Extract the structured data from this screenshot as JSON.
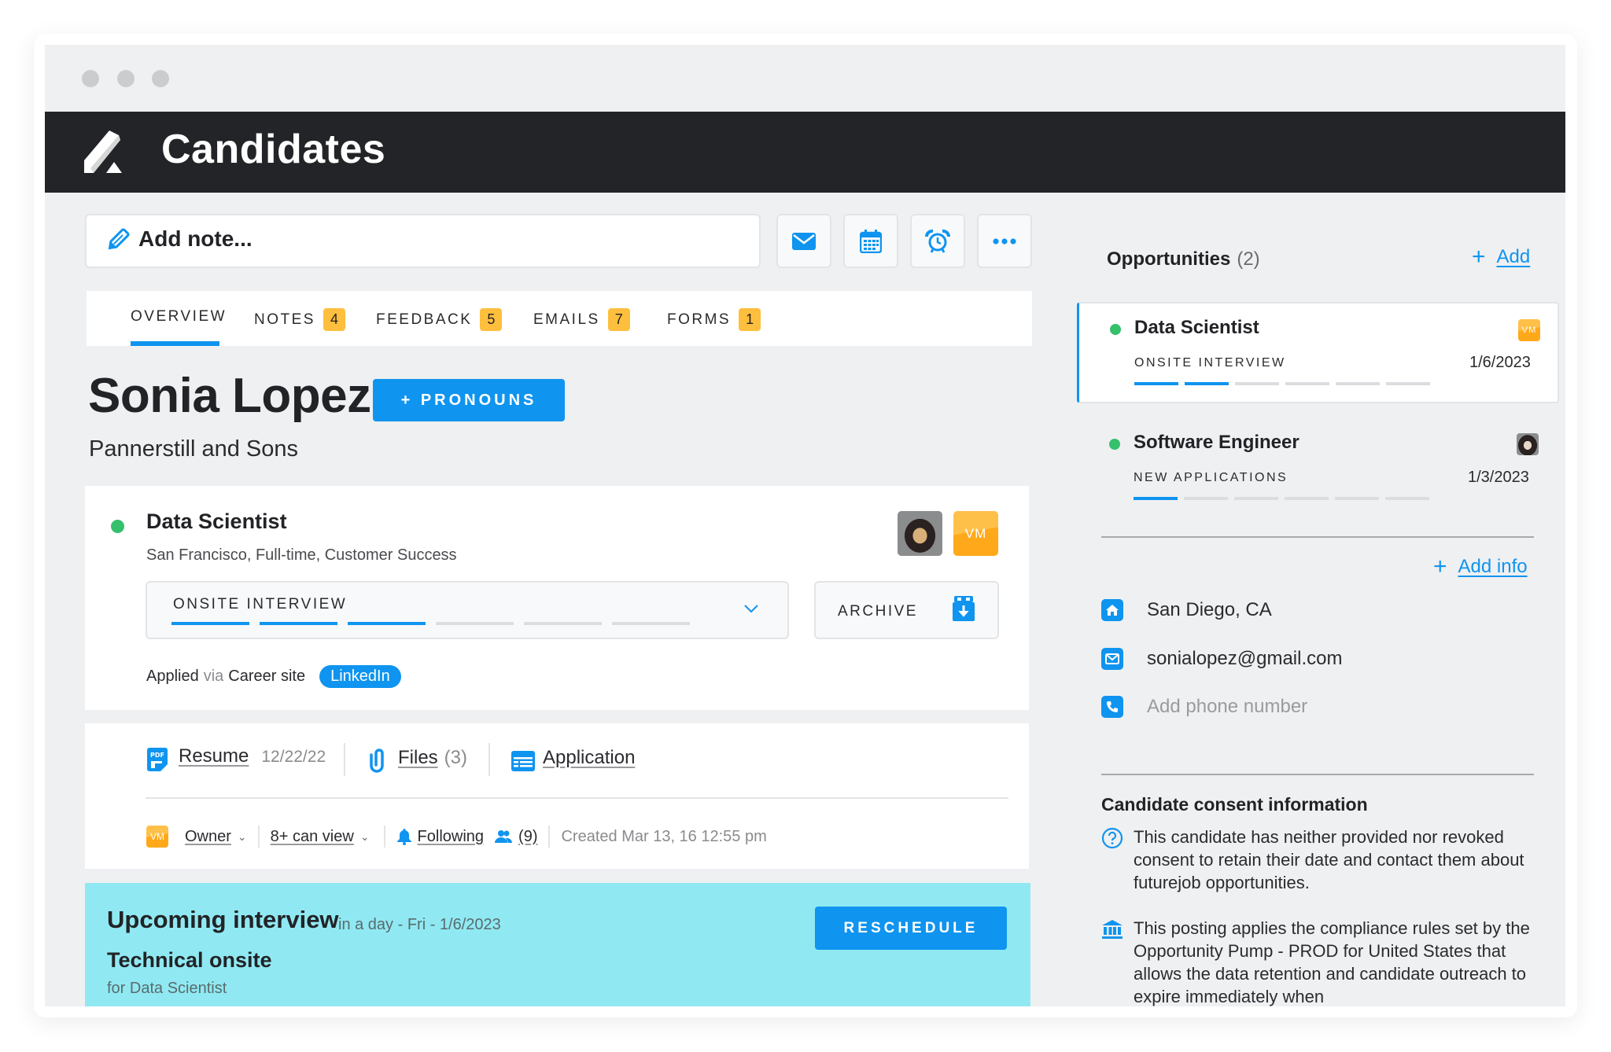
{
  "window": {
    "title": "Candidates"
  },
  "toolbar": {
    "note_placeholder": "Add note...",
    "buttons": [
      {
        "name": "email",
        "icon": "envelope-icon"
      },
      {
        "name": "schedule",
        "icon": "calendar-icon"
      },
      {
        "name": "reminder",
        "icon": "alarm-clock-icon"
      },
      {
        "name": "more",
        "icon": "more-dots-icon"
      }
    ]
  },
  "tabs": [
    {
      "label": "OVERVIEW",
      "count": null,
      "active": true
    },
    {
      "label": "NOTES",
      "count": "4"
    },
    {
      "label": "FEEDBACK",
      "count": "5"
    },
    {
      "label": "EMAILS",
      "count": "7"
    },
    {
      "label": "FORMS",
      "count": "1"
    }
  ],
  "candidate": {
    "name": "Sonia Lopez",
    "pronouns_button": "+ PRONOUNS",
    "company": "Pannerstill and Sons"
  },
  "job": {
    "title": "Data Scientist",
    "details": "San Francisco, Full-time, Customer Success",
    "owner_initials": "VM",
    "stage": "ONSITE INTERVIEW",
    "stage_progress": {
      "completed": 3,
      "total": 6
    },
    "archive_label": "ARCHIVE",
    "applied_label": "Applied",
    "via_label": "via",
    "source": "Career site",
    "source_tag": "LinkedIn"
  },
  "documents": {
    "resume_label": "Resume",
    "resume_date": "12/22/22",
    "files_label": "Files",
    "files_count": "(3)",
    "application_label": "Application",
    "owner_initials": "VM",
    "owner_label": "Owner",
    "visibility_label": "8+ can view",
    "following_label": "Following",
    "followers_count": "(9)",
    "created": "Created Mar 13, 16 12:55 pm"
  },
  "upcoming_interview": {
    "title": "Upcoming interview",
    "when": "in a day - Fri - 1/6/2023",
    "name": "Technical onsite",
    "for": "for Data Scientist",
    "reschedule_label": "RESCHEDULE"
  },
  "opportunities": {
    "title": "Opportunities",
    "count": "(2)",
    "add_label": "Add",
    "items": [
      {
        "title": "Data Scientist",
        "stage": "ONSITE INTERVIEW",
        "date": "1/6/2023",
        "owner": "VM",
        "progress": {
          "completed": 2,
          "total": 6
        },
        "selected": true
      },
      {
        "title": "Software Engineer",
        "stage": "NEW APPLICATIONS",
        "date": "1/3/2023",
        "owner": "photo",
        "progress": {
          "completed": 1,
          "total": 6
        },
        "selected": false
      }
    ]
  },
  "contact": {
    "add_info_label": "Add info",
    "location": "San Diego, CA",
    "email": "sonialopez@gmail.com",
    "phone_placeholder": "Add phone number"
  },
  "consent": {
    "title": "Candidate consent information",
    "status_text": "This candidate has neither provided nor revoked consent to retain their date and contact them about futurejob opportunities.",
    "compliance_text": "This posting applies the compliance rules set by the Opportunity Pump - PROD for United States that allows the data retention and candidate outreach to expire immediately when"
  },
  "colors": {
    "accent": "#0f94ef",
    "header_bg": "#232427",
    "badge": "#febf3e",
    "active_status": "#35c06b",
    "interview_banner": "#90e9f2",
    "page_bg": "#eff0f2"
  }
}
